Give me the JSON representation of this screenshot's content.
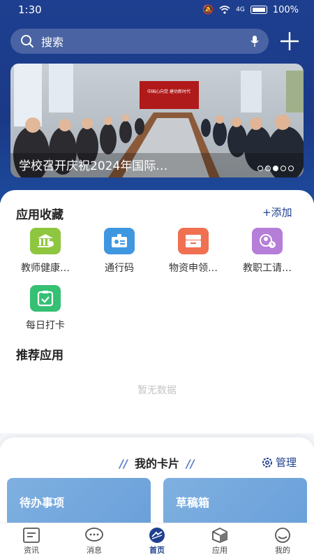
{
  "status": {
    "time": "1:30",
    "battery": "100%",
    "signal": "4G"
  },
  "search": {
    "placeholder": "搜索"
  },
  "banner": {
    "caption": "学校召开庆祝2024年国际…",
    "slide_count": 5,
    "active_slide": 3,
    "screen_text": "中国心向党 建功新时代"
  },
  "favorites": {
    "title": "应用收藏",
    "add_label": "+添加",
    "apps": [
      {
        "label": "教师健康…",
        "icon": "bank-building-icon",
        "color": "#8ec63f"
      },
      {
        "label": "通行码",
        "icon": "id-badge-icon",
        "color": "#3f97e0"
      },
      {
        "label": "物资申领…",
        "icon": "inbox-tray-icon",
        "color": "#f07052"
      },
      {
        "label": "教职工请…",
        "icon": "person-clock-icon",
        "color": "#b57ed9"
      },
      {
        "label": "每日打卡",
        "icon": "clipboard-check-icon",
        "color": "#35c074"
      }
    ]
  },
  "recommended": {
    "title": "推荐应用",
    "empty_text": "暂无数据"
  },
  "cards": {
    "title": "我的卡片",
    "manage_label": "管理",
    "items": [
      {
        "label": "待办事项"
      },
      {
        "label": "草稿箱"
      }
    ]
  },
  "nav": {
    "items": [
      {
        "label": "资讯",
        "icon": "news-icon"
      },
      {
        "label": "消息",
        "icon": "chat-bubble-icon"
      },
      {
        "label": "首页",
        "icon": "home-logo-icon",
        "active": true
      },
      {
        "label": "应用",
        "icon": "cube-icon"
      },
      {
        "label": "我的",
        "icon": "profile-icon"
      }
    ]
  }
}
